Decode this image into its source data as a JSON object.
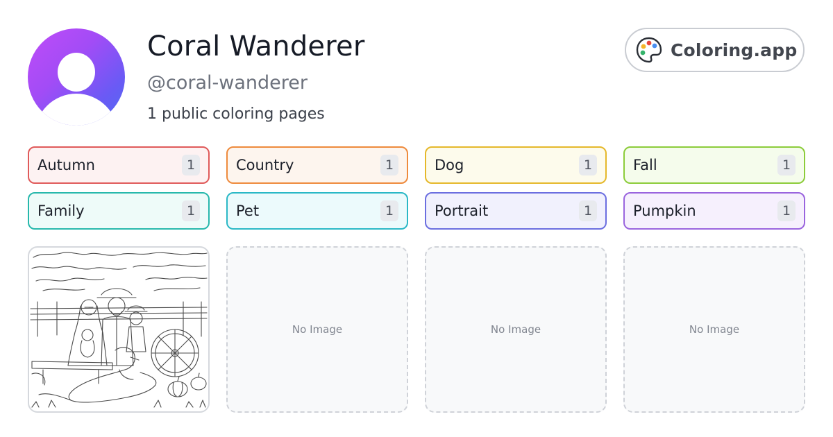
{
  "profile": {
    "name": "Coral Wanderer",
    "handle": "@coral-wanderer",
    "page_count_text": "1 public coloring pages"
  },
  "brand": {
    "label": "Coloring.app",
    "icon": "palette-icon"
  },
  "tags": [
    {
      "label": "Autumn",
      "count": "1",
      "border": "#e05a5a",
      "bg": "#fdf2f2"
    },
    {
      "label": "Country",
      "count": "1",
      "border": "#ee8a3c",
      "bg": "#fdf5ee"
    },
    {
      "label": "Dog",
      "count": "1",
      "border": "#e5b82a",
      "bg": "#fdfbec"
    },
    {
      "label": "Fall",
      "count": "1",
      "border": "#8ccc3a",
      "bg": "#f5fcec"
    },
    {
      "label": "Family",
      "count": "1",
      "border": "#27b8ac",
      "bg": "#eefbf9"
    },
    {
      "label": "Pet",
      "count": "1",
      "border": "#2ab8c6",
      "bg": "#ecfafc"
    },
    {
      "label": "Portrait",
      "count": "1",
      "border": "#6b6ee0",
      "bg": "#f1f1fd"
    },
    {
      "label": "Pumpkin",
      "count": "1",
      "border": "#9a64de",
      "bg": "#f6f0fd"
    }
  ],
  "cards": [
    {
      "type": "image"
    },
    {
      "type": "empty",
      "label": "No Image"
    },
    {
      "type": "empty",
      "label": "No Image"
    },
    {
      "type": "empty",
      "label": "No Image"
    }
  ]
}
